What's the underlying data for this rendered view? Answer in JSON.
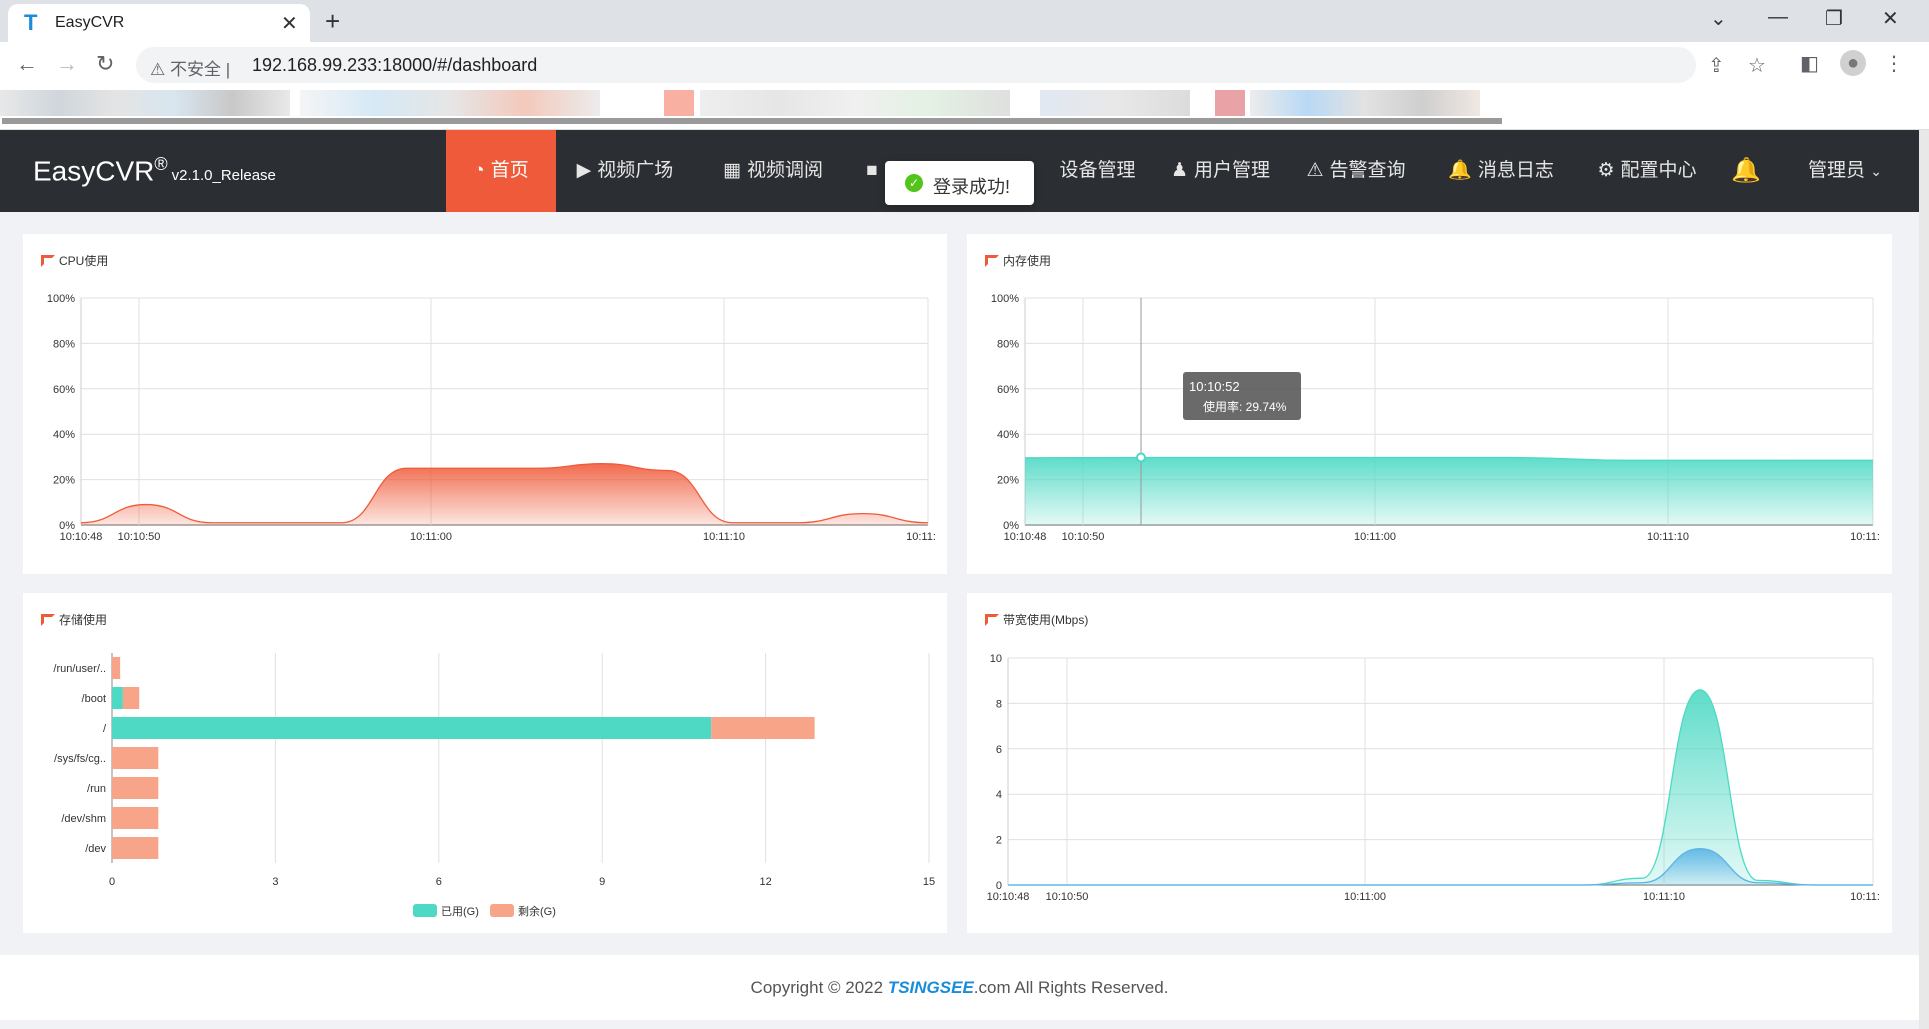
{
  "browser": {
    "tab_title": "EasyCVR",
    "security_label": "不安全",
    "url": "192.168.99.233:18000/#/dashboard"
  },
  "app": {
    "brand": "EasyCVR",
    "brand_reg": "®",
    "version": "v2.1.0_Release",
    "nav": [
      {
        "label": "首页",
        "icon": "dashboard-icon",
        "active": true
      },
      {
        "label": "视频广场",
        "icon": "play-circle-icon"
      },
      {
        "label": "视频调阅",
        "icon": "layout-icon"
      },
      {
        "label": "设备管理",
        "icon": "video-camera-icon"
      },
      {
        "label": "用户管理",
        "icon": "user-icon"
      },
      {
        "label": "告警查询",
        "icon": "alarm-icon"
      },
      {
        "label": "消息日志",
        "icon": "bell-icon"
      },
      {
        "label": "配置中心",
        "icon": "gear-icon"
      }
    ],
    "admin_label": "管理员",
    "toast": "登录成功!"
  },
  "panels": {
    "cpu_title": "CPU使用",
    "mem_title": "内存使用",
    "storage_title": "存储使用",
    "bandwidth_title": "带宽使用(Mbps)",
    "tooltip_time": "10:10:52",
    "tooltip_value": "使用率: 29.74%"
  },
  "chart_data": [
    {
      "type": "area",
      "title": "CPU使用",
      "x": [
        "10:10:48",
        "10:10:50",
        "10:10:52",
        "10:10:54",
        "10:10:56",
        "10:10:58",
        "10:11:00",
        "10:11:02",
        "10:11:04",
        "10:11:06",
        "10:11:08",
        "10:11:10",
        "10:11:12",
        "10:11:14"
      ],
      "x_ticks": [
        "10:10:48",
        "10:10:50",
        "10:11:00",
        "10:11:10",
        "10:11:"
      ],
      "values": [
        1,
        9,
        1,
        1,
        1,
        25,
        25,
        25,
        27,
        24,
        1,
        1,
        5,
        1
      ],
      "y_ticks": [
        "100%",
        "80%",
        "60%",
        "40%",
        "20%",
        "0%"
      ],
      "ylim": [
        0,
        100
      ],
      "color": "#ef5b3a"
    },
    {
      "type": "area",
      "title": "内存使用",
      "x": [
        "10:10:48",
        "10:10:50",
        "10:10:52",
        "10:11:00",
        "10:11:06",
        "10:11:08",
        "10:11:10",
        "10:11:14"
      ],
      "x_ticks": [
        "10:10:48",
        "10:10:50",
        "10:11:00",
        "10:11:10",
        "10:11:"
      ],
      "values": [
        29.6,
        29.7,
        29.74,
        29.7,
        29.7,
        28.5,
        28.5,
        28.5
      ],
      "y_ticks": [
        "100%",
        "80%",
        "60%",
        "40%",
        "20%",
        "0%"
      ],
      "ylim": [
        0,
        100
      ],
      "color": "#4dd9c4"
    },
    {
      "type": "bar",
      "title": "存储使用",
      "categories": [
        "/run/user/..",
        "/boot",
        "/",
        "/sys/fs/cg..",
        "/run",
        "/dev/shm",
        "/dev"
      ],
      "series": [
        {
          "name": "已用(G)",
          "values": [
            0,
            0.2,
            11,
            0,
            0,
            0,
            0
          ],
          "color": "#4dd9c4"
        },
        {
          "name": "剩余(G)",
          "values": [
            0.15,
            0.3,
            1.9,
            0.85,
            0.85,
            0.85,
            0.85
          ],
          "color": "#f7a488"
        }
      ],
      "x_ticks": [
        "0",
        "3",
        "6",
        "9",
        "12",
        "15"
      ],
      "xlim": [
        0,
        15
      ]
    },
    {
      "type": "area",
      "title": "带宽使用(Mbps)",
      "x_ticks": [
        "10:10:48",
        "10:10:50",
        "10:11:00",
        "10:11:10",
        "10:11:"
      ],
      "y_ticks": [
        "10",
        "8",
        "6",
        "4",
        "2",
        "0"
      ],
      "ylim": [
        0,
        10
      ],
      "series": [
        {
          "values": [
            0,
            0,
            0,
            0,
            0,
            0,
            0,
            0,
            0,
            0,
            0,
            0.3,
            8.6,
            0.2,
            0,
            0
          ],
          "color": "#4dd9c4"
        },
        {
          "values": [
            0,
            0,
            0,
            0,
            0,
            0,
            0,
            0,
            0,
            0,
            0,
            0.1,
            1.6,
            0.1,
            0,
            0
          ],
          "color": "#5ab3e6"
        }
      ]
    }
  ],
  "footer": {
    "prefix": "Copyright © 2022 ",
    "brand": "TSINGSEE",
    "suffix": ".com All Rights Reserved."
  }
}
